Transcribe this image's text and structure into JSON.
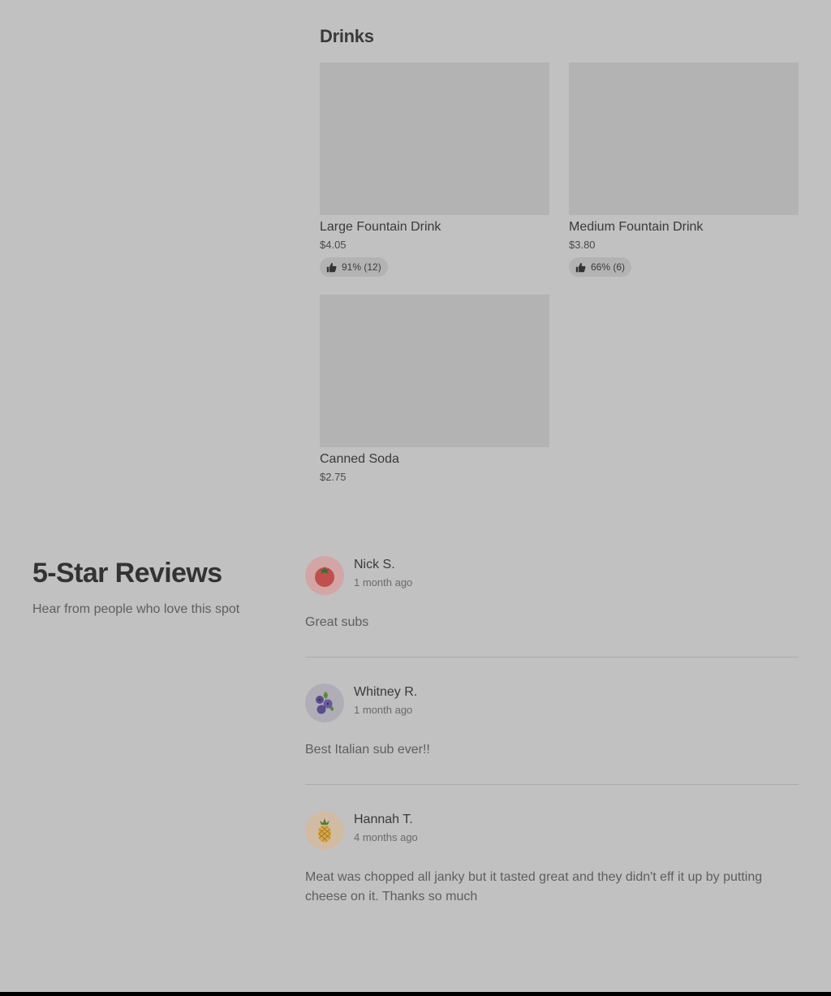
{
  "drinks": {
    "title": "Drinks",
    "items": [
      {
        "name": "Large Fountain Drink",
        "price": "$4.05",
        "rating": "91% (12)"
      },
      {
        "name": "Medium Fountain Drink",
        "price": "$3.80",
        "rating": "66% (6)"
      },
      {
        "name": "Canned Soda",
        "price": "$2.75"
      }
    ]
  },
  "reviews": {
    "title": "5-Star Reviews",
    "subtitle": "Hear from people who love this spot",
    "items": [
      {
        "name": "Nick S.",
        "time": "1 month ago",
        "text": "Great subs",
        "avatar": "tomato-icon",
        "avatar_bg": "#d4a5a5"
      },
      {
        "name": "Whitney R.",
        "time": "1 month ago",
        "text": "Best Italian sub ever!!",
        "avatar": "blueberries-icon",
        "avatar_bg": "#b0adb7"
      },
      {
        "name": "Hannah T.",
        "time": "4 months ago",
        "text": "Meat was chopped all janky but it tasted great and they didn't eff it up by putting cheese on it. Thanks so much",
        "avatar": "pineapple-icon",
        "avatar_bg": "#d1bca3"
      }
    ]
  }
}
